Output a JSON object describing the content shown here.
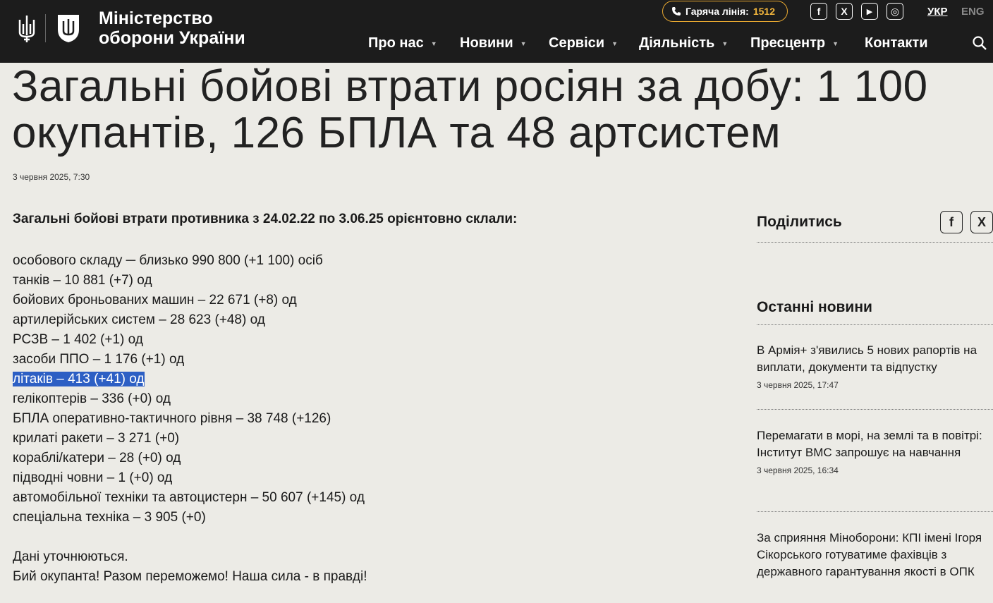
{
  "header": {
    "logo_line1": "Міністерство",
    "logo_line2": "оборони України",
    "hotline_label": "Гаряча лінія:",
    "hotline_number": "1512",
    "lang_active": "УКР",
    "lang_other": "ENG",
    "social": [
      "f",
      "X",
      "▶",
      "◎"
    ],
    "nav": [
      "Про нас",
      "Новини",
      "Сервіси",
      "Діяльність",
      "Пресцентр",
      "Контакти"
    ]
  },
  "article": {
    "title_line1": "Загальні бойові втрати росіян за добу: 1 100",
    "title_line2": "окупантів, 126 БПЛА та 48 артсистем",
    "date": "3 червня 2025, 7:30",
    "lead": "Загальні бойові втрати противника з 24.02.22 по 3.06.25 орієнтовно склали:",
    "stats": [
      "особового складу ─ близько 990 800 (+1 100) осіб",
      "танків ‒ 10 881 (+7) од",
      "бойових броньованих машин ‒ 22 671 (+8) од",
      "артилерійських систем – 28 623 (+48) од",
      "РСЗВ – 1 402 (+1) од",
      "засоби ППО ‒ 1 176 (+1) од",
      "літаків – 413 (+41) од",
      "гелікоптерів – 336 (+0) од",
      "БПЛА оперативно-тактичного рівня – 38 748 (+126)",
      "крилаті ракети ‒ 3 271 (+0)",
      "кораблі/катери ‒ 28 (+0) од",
      "підводні човни ‒ 1 (+0) од",
      "автомобільної техніки та автоцистерн – 50 607 (+145) од",
      "спеціальна техніка ‒  3 905 (+0)"
    ],
    "footer_line1": "Дані уточнюються.",
    "footer_line2": "Бий окупанта! Разом переможемо! Наша сила - в правді!"
  },
  "sidebar": {
    "share_title": "Поділитись",
    "share_buttons": [
      "f",
      "X"
    ],
    "latest_title": "Останні новини",
    "news": [
      {
        "title": "В Армія+ з'явились 5 нових рапортів на виплати, документи та відпустку",
        "date": "3 червня 2025, 17:47"
      },
      {
        "title": "Перемагати в морі, на землі та в повітрі: Інститут ВМС запрошує на навчання",
        "date": "3 червня 2025, 16:34"
      },
      {
        "title": "За сприяння Міноборони: КПІ імені Ігоря Сікорського готуватиме фахівців з державного гарантування якості в ОПК",
        "date": ""
      }
    ]
  },
  "colors": {
    "header_bg": "#1c1c1c",
    "page_bg": "#ecebe6",
    "hotline_accent": "#f0b43c",
    "highlight": "#2d5fc4"
  },
  "icons": [
    "tryzub-icon",
    "shield-icon",
    "phone-icon",
    "facebook-icon",
    "x-icon",
    "youtube-icon",
    "instagram-icon",
    "search-icon"
  ]
}
